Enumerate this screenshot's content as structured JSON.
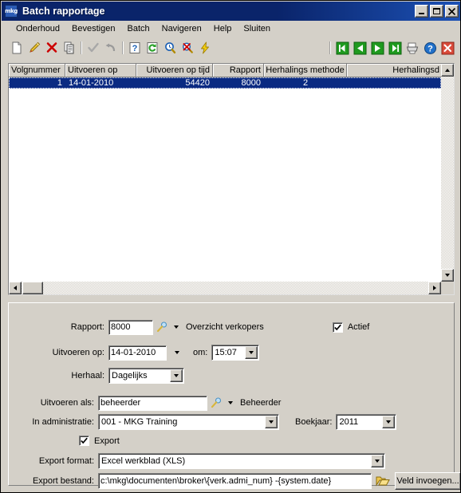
{
  "window": {
    "title": "Batch rapportage",
    "app_icon_label": "mkg",
    "controls": {
      "minimize": "_",
      "maximize": "□",
      "close": "✕"
    }
  },
  "menubar": {
    "items": [
      {
        "label": "Onderhoud"
      },
      {
        "label": "Bevestigen"
      },
      {
        "label": "Batch"
      },
      {
        "label": "Navigeren"
      },
      {
        "label": "Help"
      },
      {
        "label": "Sluiten"
      }
    ]
  },
  "toolbar": {
    "left_tools": [
      {
        "name": "new-document-icon",
        "title": "Nieuw"
      },
      {
        "name": "edit-pencil-icon",
        "title": "Wijzigen"
      },
      {
        "name": "delete-x-icon",
        "title": "Verwijderen"
      },
      {
        "name": "copy-icon",
        "title": "Kopieren"
      },
      {
        "name": "confirm-check-icon",
        "title": "Bevestigen"
      },
      {
        "name": "undo-arrow-icon",
        "title": "Ongedaan maken"
      },
      {
        "name": "help-question-icon",
        "title": "Info"
      },
      {
        "name": "refresh-icon",
        "title": "Verversen"
      },
      {
        "name": "search-clock-icon",
        "title": "Zoeken"
      },
      {
        "name": "cancel-search-icon",
        "title": "Zoeken annuleren"
      },
      {
        "name": "lightning-icon",
        "title": "Uitvoeren"
      }
    ],
    "right_tools": [
      {
        "name": "nav-first-icon",
        "title": "Eerste"
      },
      {
        "name": "nav-previous-icon",
        "title": "Vorige"
      },
      {
        "name": "nav-next-icon",
        "title": "Volgende"
      },
      {
        "name": "nav-last-icon",
        "title": "Laatste"
      },
      {
        "name": "print-icon",
        "title": "Afdrukken"
      },
      {
        "name": "help-icon",
        "title": "Help"
      },
      {
        "name": "close-window-icon",
        "title": "Sluiten"
      }
    ]
  },
  "grid": {
    "columns": [
      {
        "label": "Volgnummer",
        "width": 71,
        "align": "left"
      },
      {
        "label": "Uitvoeren op",
        "width": 89,
        "align": "left"
      },
      {
        "label": "Uitvoeren op tijd",
        "width": 96,
        "align": "right"
      },
      {
        "label": "Rapport",
        "width": 64,
        "align": "right"
      },
      {
        "label": "Herhalings methode",
        "width": 104,
        "align": "center"
      },
      {
        "label": "Herhalingsd",
        "width": 120,
        "align": "right"
      }
    ],
    "rows": [
      {
        "volgnummer": "1",
        "uitvoeren_op": "14-01-2010",
        "uitvoeren_op_tijd": "54420",
        "rapport": "8000",
        "herhalings_methode": "2",
        "herhalingsd": "",
        "selected": true
      }
    ]
  },
  "form": {
    "rapport": {
      "label": "Rapport:",
      "value": "8000",
      "lookup_icon": "magnifier-wand-icon",
      "dropdown_icon": "chevron-down-icon",
      "description": "Overzicht verkopers"
    },
    "actief": {
      "label": "Actief",
      "checked": true
    },
    "uitvoeren_op": {
      "label": "Uitvoeren op:",
      "value": "14-01-2010",
      "dropdown_icon": "chevron-down-icon"
    },
    "om": {
      "label": "om:",
      "value": "15:07",
      "dropdown_icon": "chevron-down-icon"
    },
    "herhaal": {
      "label": "Herhaal:",
      "value": "Dagelijks",
      "dropdown_icon": "chevron-down-icon"
    },
    "uitvoeren_als": {
      "label": "Uitvoeren als:",
      "value": "beheerder",
      "lookup_icon": "magnifier-wand-icon",
      "dropdown_icon": "chevron-down-icon",
      "description": "Beheerder"
    },
    "in_administratie": {
      "label": "In administratie:",
      "value": "001 - MKG Training",
      "dropdown_icon": "chevron-down-icon"
    },
    "boekjaar": {
      "label": "Boekjaar:",
      "value": "2011",
      "dropdown_icon": "chevron-down-icon"
    },
    "export": {
      "label": "Export",
      "checked": true
    },
    "export_format": {
      "label": "Export format:",
      "value": "Excel werkblad (XLS)",
      "dropdown_icon": "chevron-down-icon"
    },
    "export_bestand": {
      "label": "Export bestand:",
      "value": "c:\\mkg\\documenten\\broker\\{verk.admi_num} -{system.date}",
      "browse_icon": "open-folder-icon",
      "insert_button": "Veld invoegen..."
    }
  },
  "colors": {
    "titlebar": "#0a246a",
    "window_face": "#d4d0c8",
    "selection": "#0a2a82",
    "field_bg": "#ffffff"
  }
}
